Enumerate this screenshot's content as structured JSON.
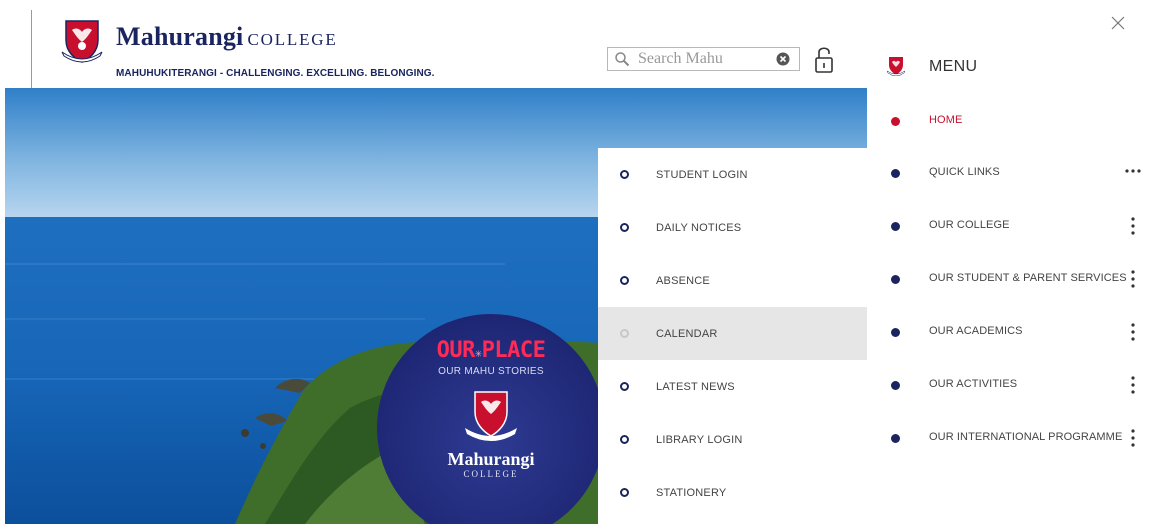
{
  "header": {
    "brand_name": "Mahurangi",
    "brand_suffix": "COLLEGE",
    "tagline": "MAHUHUKITERANGI - CHALLENGING. EXCELLING. BELONGING.",
    "search_placeholder": "Search Mahu"
  },
  "hero": {
    "badge_title_1": "OUR",
    "badge_title_2": "PLACE",
    "badge_subtitle": "OUR MAHU STORIES",
    "badge_name": "Mahurangi",
    "badge_college": "COLLEGE"
  },
  "quick_links": {
    "items": [
      {
        "label": "STUDENT LOGIN"
      },
      {
        "label": "DAILY NOTICES"
      },
      {
        "label": "ABSENCE"
      },
      {
        "label": "CALENDAR"
      },
      {
        "label": "LATEST NEWS"
      },
      {
        "label": "LIBRARY LOGIN"
      },
      {
        "label": "STATIONERY"
      }
    ],
    "active_item": "CALENDAR"
  },
  "menu": {
    "title": "MENU",
    "items": [
      {
        "label": "HOME"
      },
      {
        "label": "QUICK LINKS"
      },
      {
        "label": "OUR COLLEGE"
      },
      {
        "label": "OUR STUDENT & PARENT SERVICES"
      },
      {
        "label": "OUR ACADEMICS"
      },
      {
        "label": "OUR ACTIVITIES"
      },
      {
        "label": "OUR INTERNATIONAL PROGRAMME"
      }
    ],
    "current_item": "HOME"
  },
  "colors": {
    "brand_navy": "#1a2560",
    "accent_red": "#c8102e",
    "active_row_bg": "#e7e6e6"
  },
  "icons": {
    "search": "magnifier-icon",
    "clear": "clear-circle-x-icon",
    "login": "unlocked-padlock-icon",
    "close": "close-x-icon",
    "more": "vertical-ellipsis-icon"
  }
}
